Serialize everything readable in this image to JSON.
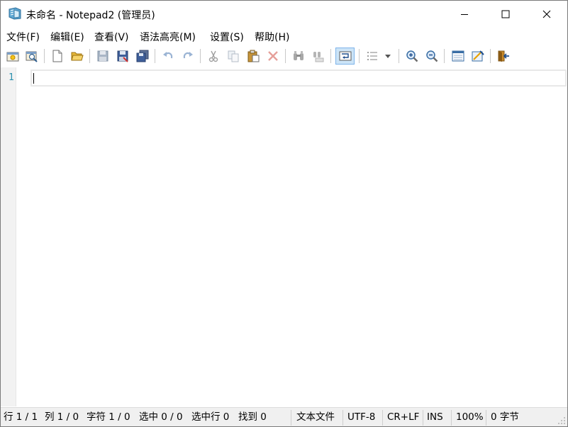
{
  "window": {
    "title": "未命名 - Notepad2 (管理员)"
  },
  "menu": {
    "items": [
      "文件(F)",
      "编辑(E)",
      "查看(V)",
      "语法高亮(M)",
      "设置(S)",
      "帮助(H)"
    ]
  },
  "toolbar": {
    "buttons": [
      {
        "name": "new-window-icon"
      },
      {
        "name": "browse-icon"
      },
      {
        "name": "new-file-icon"
      },
      {
        "name": "open-file-icon"
      },
      {
        "name": "save-icon"
      },
      {
        "name": "save-as-icon"
      },
      {
        "name": "save-all-icon"
      },
      {
        "name": "undo-icon"
      },
      {
        "name": "redo-icon"
      },
      {
        "name": "cut-icon"
      },
      {
        "name": "copy-icon"
      },
      {
        "name": "paste-icon"
      },
      {
        "name": "delete-icon"
      },
      {
        "name": "find-icon"
      },
      {
        "name": "replace-icon"
      },
      {
        "name": "word-wrap-icon"
      },
      {
        "name": "list-icon"
      },
      {
        "name": "dropdown-arrow-icon"
      },
      {
        "name": "zoom-in-icon"
      },
      {
        "name": "zoom-out-icon"
      },
      {
        "name": "schema-icon"
      },
      {
        "name": "customize-icon"
      },
      {
        "name": "exit-icon"
      }
    ]
  },
  "editor": {
    "line_numbers": [
      "1"
    ]
  },
  "status": {
    "line": "行 1 / 1",
    "column": "列 1 / 0",
    "chars": "字符 1 / 0",
    "selection": "选中 0 / 0",
    "selected_lines": "选中行 0",
    "found": "找到 0",
    "file_type": "文本文件",
    "encoding": "UTF-8",
    "line_ending": "CR+LF",
    "insert_mode": "INS",
    "zoom": "100%",
    "bytes": "0 字节"
  },
  "colors": {
    "line_number": "#2b91af",
    "gutter": "#f2f2f2",
    "statusbar": "#f0f0f0",
    "active_button_bg": "#cce4f7",
    "active_button_border": "#7eb4ea"
  }
}
